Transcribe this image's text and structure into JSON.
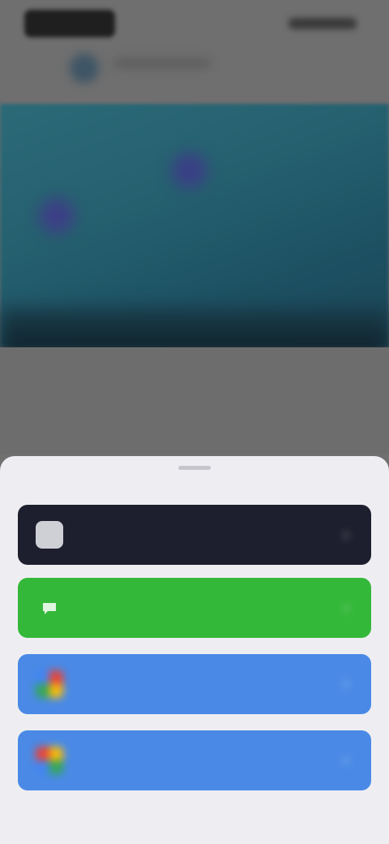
{
  "background": {
    "status_time": "",
    "header_title": ""
  },
  "sheet": {
    "options": [
      {
        "label": "",
        "icon": "app-icon",
        "color": "#1e1f2e"
      },
      {
        "label": "",
        "icon": "message-icon",
        "color": "#34b83a"
      },
      {
        "label": "",
        "icon": "google-icon",
        "color": "#4a8ae6"
      },
      {
        "label": "",
        "icon": "google-icon",
        "color": "#4a8ae6"
      }
    ],
    "chevron": "›"
  },
  "colors": {
    "sheet_background": "#eeeef2",
    "dim_overlay": "#6f6f6f"
  }
}
